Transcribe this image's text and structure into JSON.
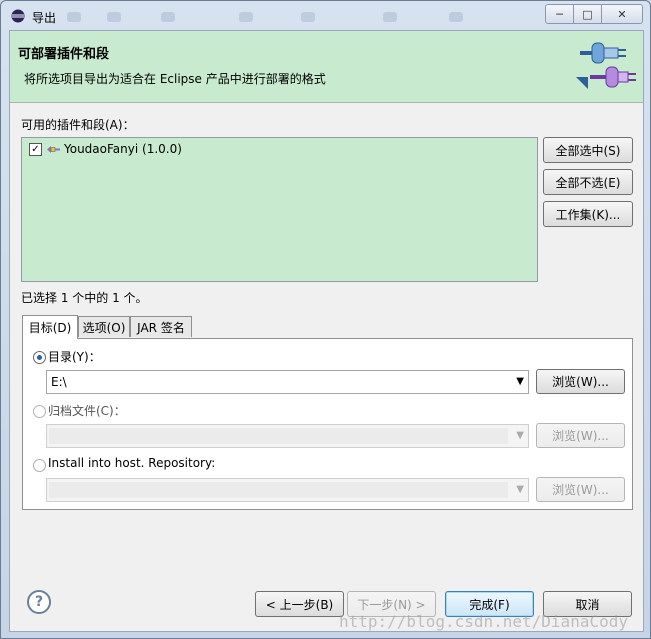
{
  "window": {
    "title": "导出",
    "controls": {
      "minimize": "─",
      "maximize": "□",
      "close": "✕"
    }
  },
  "banner": {
    "title": "可部署插件和段",
    "description": "将所选项目导出为适合在 Eclipse 产品中进行部署的格式",
    "icon": "plugin-export-icon"
  },
  "plugins": {
    "label": "可用的插件和段(A)：",
    "items": [
      {
        "name": "YoudaoFanyi (1.0.0)",
        "checked": true,
        "icon": "plugin-icon"
      }
    ],
    "buttons": {
      "select_all": "全部选中(S)",
      "deselect_all": "全部不选(E)",
      "working_set": "工作集(K)..."
    },
    "status": "已选择 1 个中的 1 个。"
  },
  "tabs": [
    {
      "label": "目标(D)",
      "active": true
    },
    {
      "label": "选项(O)",
      "active": false
    },
    {
      "label": "JAR 签名",
      "active": false
    }
  ],
  "destination": {
    "directory": {
      "label": "目录(Y)：",
      "selected": true,
      "value": "E:\\",
      "browse": "浏览(W)..."
    },
    "archive": {
      "label": "归档文件(C)：",
      "selected": false,
      "value": "",
      "browse": "浏览(W)..."
    },
    "repository": {
      "label": "Install into host. Repository:",
      "selected": false,
      "value": "",
      "browse": "浏览(W)..."
    }
  },
  "footer": {
    "help_icon": "help-icon",
    "help_glyph": "?",
    "back": "< 上一步(B)",
    "next": "下一步(N) >",
    "finish": "完成(F)",
    "cancel": "取消"
  },
  "watermark": "http://blog.csdn.net/DianaCody",
  "colors": {
    "banner_bg": "#c8ebcf",
    "list_bg": "#c8ebcf",
    "default_button_border": "#3c7fb1"
  }
}
